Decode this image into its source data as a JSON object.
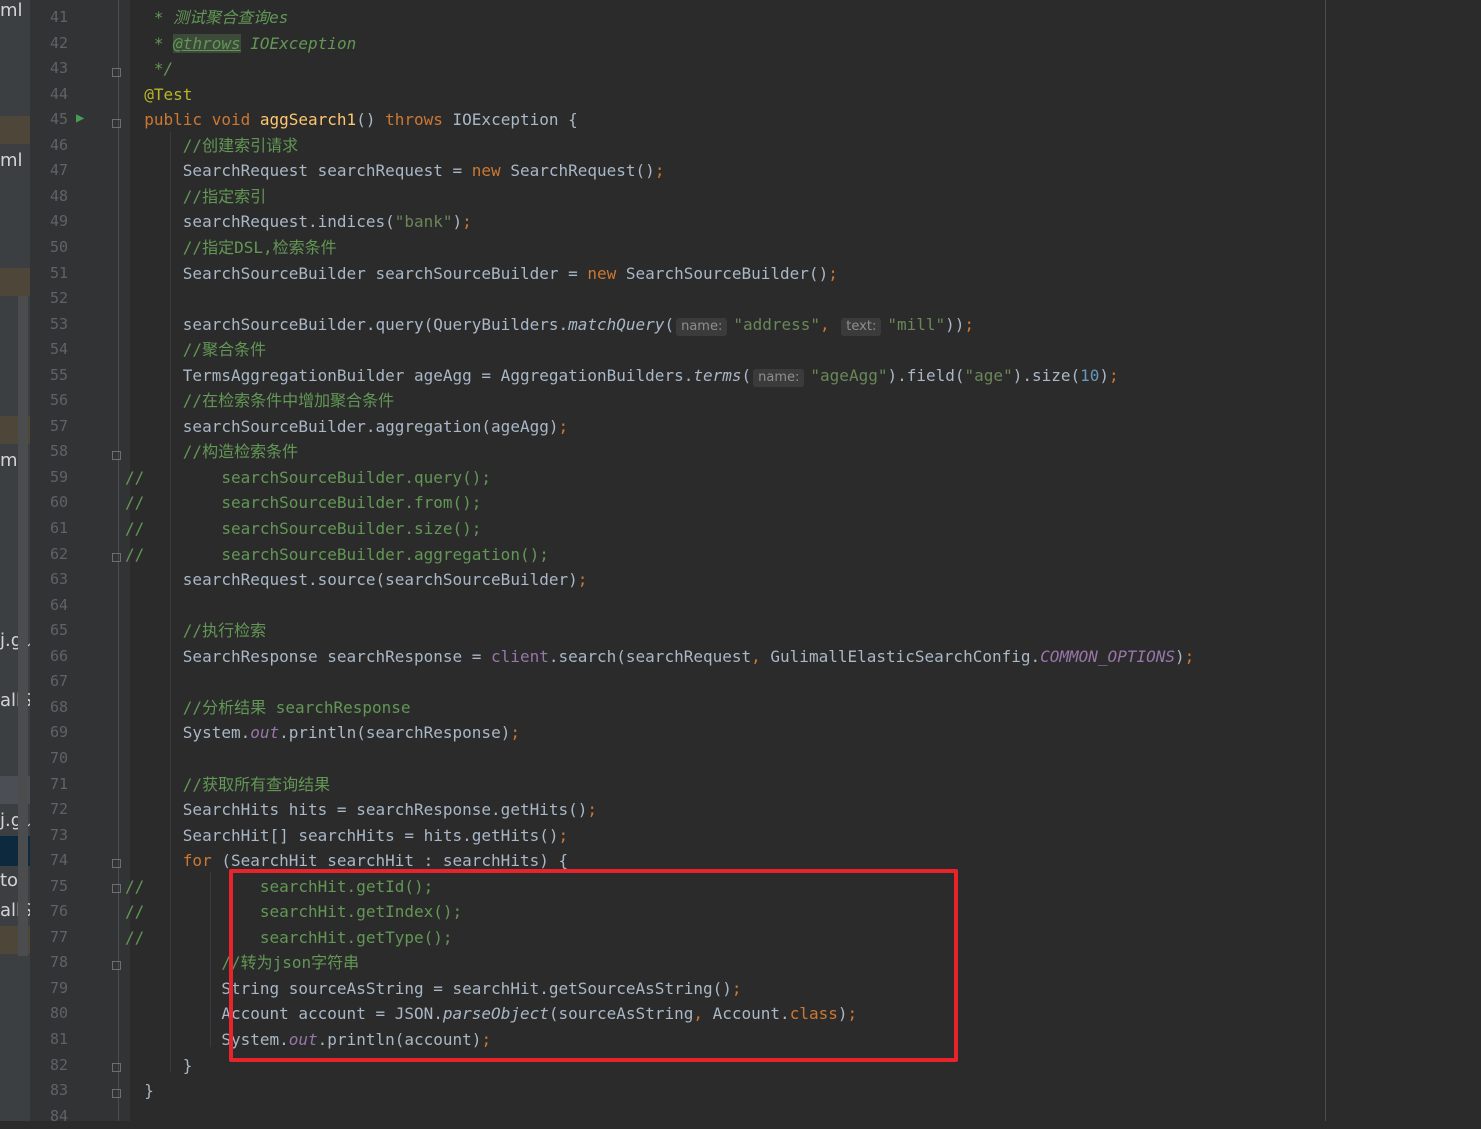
{
  "left_strip": {
    "labels": [
      "ml",
      "ml",
      "ml",
      "j.gu",
      "allSe",
      "j.gu",
      "tour",
      "allSe"
    ]
  },
  "editor": {
    "lines": [
      {
        "n": "41",
        "html": "  <span class='jd'> * 测试聚合查询es</span>"
      },
      {
        "n": "42",
        "html": "  <span class='jd'> * </span><span class='jdtag'>@throws</span><span class='jd'> IOException</span>"
      },
      {
        "n": "43",
        "html": "  <span class='jd'> */</span>"
      },
      {
        "n": "44",
        "html": "  <span class='ann'>@Test</span>"
      },
      {
        "n": "45",
        "html": "  <span class='kw'>public void </span><span class='fn'>aggSearch1</span>() <span class='kw'>throws </span>IOException {"
      },
      {
        "n": "46",
        "html": "      <span class='cm'>//创建索引请求</span>"
      },
      {
        "n": "47",
        "html": "      SearchRequest searchRequest = <span class='kw'>new </span>SearchRequest()<span class='kw'>;</span>"
      },
      {
        "n": "48",
        "html": "      <span class='cm'>//指定索引</span>"
      },
      {
        "n": "49",
        "html": "      searchRequest.indices(<span class='str'>\"bank\"</span>)<span class='kw'>;</span>"
      },
      {
        "n": "50",
        "html": "      <span class='cm'>//指定DSL,检索条件</span>"
      },
      {
        "n": "51",
        "html": "      SearchSourceBuilder searchSourceBuilder = <span class='kw'>new </span>SearchSourceBuilder()<span class='kw'>;</span>"
      },
      {
        "n": "52",
        "html": ""
      },
      {
        "n": "53",
        "html": "      searchSourceBuilder.query(QueryBuilders.<span class='st'>matchQuery</span>(<span class='hint'>name:</span><span class='str'>\"address\"</span><span class='kw'>, </span><span class='hint'>text:</span><span class='str'>\"mill\"</span>))<span class='kw'>;</span>"
      },
      {
        "n": "54",
        "html": "      <span class='cm'>//聚合条件</span>"
      },
      {
        "n": "55",
        "html": "      TermsAggregationBuilder ageAgg = AggregationBuilders.<span class='st'>terms</span>(<span class='hint'>name:</span><span class='str'>\"ageAgg\"</span>).field(<span class='str'>\"age\"</span>).size(<span class='num'>10</span>)<span class='kw'>;</span>"
      },
      {
        "n": "56",
        "html": "      <span class='cm'>//在检索条件中增加聚合条件</span>"
      },
      {
        "n": "57",
        "html": "      searchSourceBuilder.aggregation(ageAgg)<span class='kw'>;</span>"
      },
      {
        "n": "58",
        "html": "      <span class='cm'>//构造检索条件</span>"
      },
      {
        "n": "59",
        "html": "<span class='cm'>//        searchSourceBuilder.query();</span>"
      },
      {
        "n": "60",
        "html": "<span class='cm'>//        searchSourceBuilder.from();</span>"
      },
      {
        "n": "61",
        "html": "<span class='cm'>//        searchSourceBuilder.size();</span>"
      },
      {
        "n": "62",
        "html": "<span class='cm'>//        searchSourceBuilder.aggregation();</span>"
      },
      {
        "n": "63",
        "html": "      searchRequest.source(searchSourceBuilder)<span class='kw'>;</span>"
      },
      {
        "n": "64",
        "html": ""
      },
      {
        "n": "65",
        "html": "      <span class='cm'>//执行检索</span>"
      },
      {
        "n": "66",
        "html": "      SearchResponse searchResponse = <span class='fld'>client</span>.search(searchRequest<span class='kw'>, </span>GulimallElasticSearchConfig.<span class='fld st'>COMMON_OPTIONS</span>)<span class='kw'>;</span>"
      },
      {
        "n": "67",
        "html": ""
      },
      {
        "n": "68",
        "html": "      <span class='cm'>//分析结果 searchResponse</span>"
      },
      {
        "n": "69",
        "html": "      System.<span class='fld st'>out</span>.println(searchResponse)<span class='kw'>;</span>"
      },
      {
        "n": "70",
        "html": ""
      },
      {
        "n": "71",
        "html": "      <span class='cm'>//获取所有查询结果</span>"
      },
      {
        "n": "72",
        "html": "      SearchHits hits = searchResponse.getHits()<span class='kw'>;</span>"
      },
      {
        "n": "73",
        "html": "      SearchHit[] searchHits = hits.getHits()<span class='kw'>;</span>"
      },
      {
        "n": "74",
        "html": "      <span class='kw'>for </span>(SearchHit searchHit : searchHits) {"
      },
      {
        "n": "75",
        "html": "<span class='cm'>//            searchHit.getId();</span>"
      },
      {
        "n": "76",
        "html": "<span class='cm'>//            searchHit.getIndex();</span>"
      },
      {
        "n": "77",
        "html": "<span class='cm'>//            searchHit.getType();</span>"
      },
      {
        "n": "78",
        "html": "          <span class='cm'>//转为json字符串</span>"
      },
      {
        "n": "79",
        "html": "          String sourceAsString = searchHit.getSourceAsString()<span class='kw'>;</span>"
      },
      {
        "n": "80",
        "html": "          Account account = JSON.<span class='st'>parseObject</span>(sourceAsString<span class='kw'>, </span>Account.<span class='kw'>class</span>)<span class='kw'>;</span>"
      },
      {
        "n": "81",
        "html": "          System.<span class='fld st'>out</span>.println(account)<span class='kw'>;</span>"
      },
      {
        "n": "82",
        "html": "      }"
      },
      {
        "n": "83",
        "html": "  }"
      },
      {
        "n": "84",
        "html": ""
      }
    ]
  },
  "colors": {
    "background": "#2b2b2b",
    "keyword": "#cc7832",
    "string": "#6a8759",
    "comment": "#629755",
    "highlight_box": "#e8232b"
  }
}
